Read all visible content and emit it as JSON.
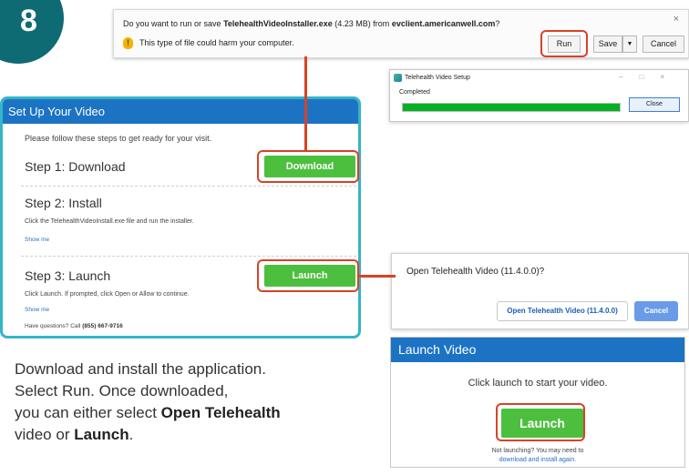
{
  "step_badge": "8",
  "download_bar": {
    "question_prefix": "Do you want to run or save ",
    "file_name": "TelehealthVideoInstaller.exe",
    "file_size": " (4.23 MB) from ",
    "source": "evclient.americanwell.com",
    "question_suffix": "?",
    "warning": "This type of file could harm your computer.",
    "run_label": "Run",
    "save_label": "Save",
    "dropdown_glyph": "▼",
    "cancel_label": "Cancel",
    "close_glyph": "×"
  },
  "setup_dialog": {
    "title": "Telehealth Video Setup",
    "status": "Completed",
    "progress_fraction": 1.0,
    "close_label": "Close",
    "window_controls": "–□×"
  },
  "setup_panel": {
    "title": "Set Up Your Video",
    "intro": "Please follow these steps to get ready for your visit.",
    "step1_title": "Step 1: Download",
    "download_button": "Download",
    "step2_title": "Step 2: Install",
    "step2_text": "Click the TelehealthVideoInstall.exe file and run the installer.",
    "step2_link": "Show me",
    "step3_title": "Step 3: Launch",
    "step3_text": "Click Launch. If prompted, click Open or Allow to continue.",
    "step3_link": "Show me",
    "launch_button": "Launch",
    "help_prefix": "Have questions? Call ",
    "help_phone": "(855) 667-9716"
  },
  "open_dialog": {
    "title": "Open Telehealth Video (11.4.0.0)?",
    "open_button": "Open Telehealth Video (11.4.0.0)",
    "cancel_button": "Cancel"
  },
  "launch_panel": {
    "title": "Launch Video",
    "message": "Click launch to start your video.",
    "launch_button": "Launch",
    "note": "Not launching? You may need to",
    "link": "download and install again."
  },
  "instructions": {
    "line1": "Download and install the application.",
    "line2": "Select Run. Once downloaded,",
    "line3_prefix": "you can either select ",
    "line3_bold": "Open Telehealth",
    "line4_prefix": "video or ",
    "line4_bold": "Launch",
    "line4_suffix": "."
  },
  "colors": {
    "badge": "#0e6a73",
    "highlight": "#d94225",
    "header_blue": "#1c73c4",
    "button_green": "#4cbf3f",
    "panel_border": "#34b5c8"
  }
}
